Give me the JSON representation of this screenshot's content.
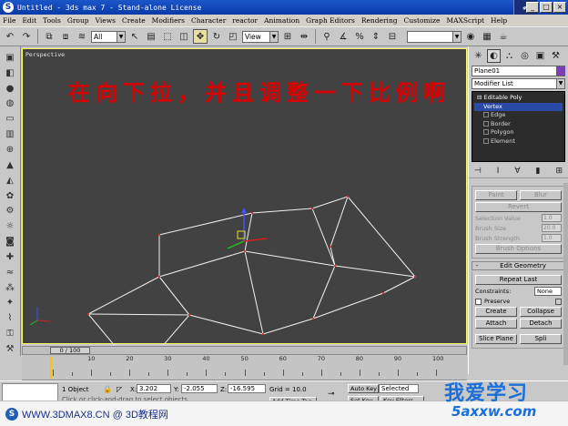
{
  "window": {
    "app_icon": "3ds-max-icon",
    "title": "Untitled - 3ds max 7 - Stand-alone License",
    "buttons": [
      "_",
      "□",
      "×"
    ]
  },
  "menu": [
    "File",
    "Edit",
    "Tools",
    "Group",
    "Views",
    "Create",
    "Modifiers",
    "Character",
    "reactor",
    "Animation",
    "Graph Editors",
    "Rendering",
    "Customize",
    "MAXScript",
    "Help"
  ],
  "toolbar": {
    "selection_filter": "All",
    "ref_coord": "View",
    "icons": [
      "undo-icon",
      "redo-icon",
      "link-icon",
      "unlink-icon",
      "bind-space-warp-icon",
      "select-icon",
      "select-by-name-icon",
      "region-select-icon",
      "window-crossing-icon",
      "move-icon",
      "rotate-icon",
      "scale-icon",
      "pivot-icon",
      "mirror-icon",
      "align-icon",
      "snap-icon",
      "angle-snap-icon",
      "percent-snap-icon",
      "spinner-snap-icon",
      "named-selection-icon",
      "material-editor-icon",
      "render-scene-icon",
      "quick-render-icon"
    ]
  },
  "viewport": {
    "label": "Perspective",
    "overlay_text": "在向下拉，并且调整一下比例啊"
  },
  "command_panel": {
    "object_name": "Plane01",
    "object_color": "#7b3fb5",
    "modifier_list": "Modifier List",
    "stack": [
      {
        "label": "Editable Poly",
        "level": "root"
      },
      {
        "label": "Vertex",
        "level": "sub",
        "selected": true
      },
      {
        "label": "Edge",
        "level": "sub"
      },
      {
        "label": "Border",
        "level": "sub"
      },
      {
        "label": "Polygon",
        "level": "sub"
      },
      {
        "label": "Element",
        "level": "sub"
      }
    ],
    "soft_sel": {
      "paint": "Paint",
      "blur": "Blur",
      "revert": "Revert",
      "selection_value": "Selection Value",
      "selection_value_num": "1.0",
      "brush_size": "Brush Size",
      "brush_size_num": "20.0",
      "brush_strength": "Brush Strength",
      "brush_strength_num": "1.0",
      "brush_options": "Brush Options"
    },
    "edit_geometry": {
      "title": "Edit Geometry",
      "repeat_last": "Repeat Last",
      "constraints_label": "Constraints:",
      "constraints_value": "None",
      "preserve": "Preserve",
      "create": "Create",
      "collapse": "Collapse",
      "attach": "Attach",
      "detach": "Detach",
      "slice_plane": "Slice Plane",
      "split": "Spli"
    }
  },
  "timeline": {
    "slider_text": "0 / 100",
    "ticks": [
      "0",
      "10",
      "20",
      "30",
      "40",
      "50",
      "60",
      "70",
      "80",
      "90",
      "100"
    ]
  },
  "status": {
    "selection": "1 Object",
    "x": "3.202",
    "y": "-2.055",
    "z": "-16.595",
    "grid": "Grid = 10.0",
    "auto_key": "Auto Key",
    "auto_key_mode": "Selected",
    "set_key": "Set Key",
    "key_filters": "Key Filters...",
    "prompt": "Click or click-and-drag to select objects",
    "add_time_tag": "Add Time Tag"
  },
  "footer": {
    "text": "WWW.3DMAX8.CN @ 3D教程网",
    "brand_cn": "我爱学习",
    "brand_url": "5axxw.com"
  },
  "mesh": {
    "vertices": [
      [
        72,
        291
      ],
      [
        150,
        204
      ],
      [
        127,
        357
      ],
      [
        150,
        250
      ],
      [
        183,
        292
      ],
      [
        252,
        180
      ],
      [
        244,
        222
      ],
      [
        264,
        313
      ],
      [
        318,
        175
      ],
      [
        319,
        296
      ],
      [
        357,
        162
      ],
      [
        343,
        238
      ],
      [
        431,
        250
      ],
      [
        338,
        217
      ],
      [
        396,
        268
      ]
    ],
    "edges": [
      [
        2,
        0
      ],
      [
        0,
        4
      ],
      [
        4,
        7
      ],
      [
        7,
        9
      ],
      [
        9,
        14
      ],
      [
        14,
        12
      ],
      [
        0,
        3
      ],
      [
        3,
        6
      ],
      [
        6,
        11
      ],
      [
        11,
        12
      ],
      [
        3,
        1
      ],
      [
        1,
        5
      ],
      [
        5,
        8
      ],
      [
        8,
        10
      ],
      [
        10,
        13
      ],
      [
        13,
        11
      ],
      [
        1,
        3
      ],
      [
        5,
        6
      ],
      [
        8,
        11
      ],
      [
        10,
        12
      ],
      [
        2,
        4
      ],
      [
        3,
        4
      ],
      [
        6,
        7
      ],
      [
        11,
        9
      ],
      [
        4,
        3
      ]
    ]
  }
}
